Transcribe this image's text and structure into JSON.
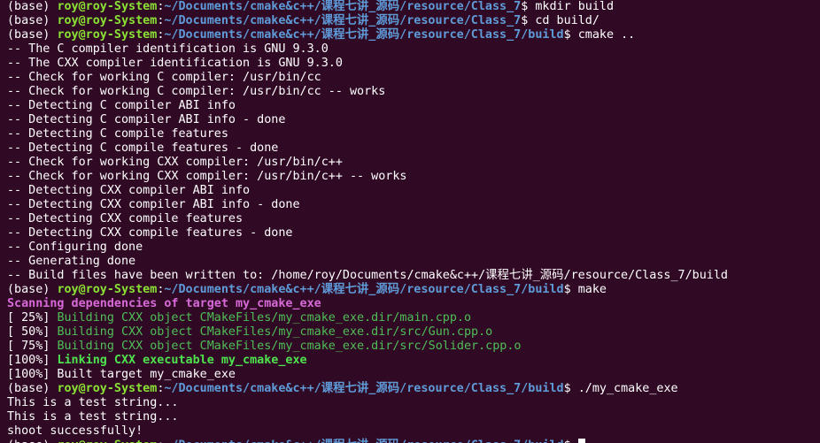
{
  "prompt": {
    "base": "(base) ",
    "user": "roy@roy-System",
    "colon": ":",
    "path_class": "~/Documents/cmake&c++/课程七讲_源码/resource/Class_7",
    "path_build": "~/Documents/cmake&c++/课程七讲_源码/resource/Class_7/build",
    "dollar": "$ "
  },
  "commands": {
    "mkdir": "mkdir build",
    "cd": "cd build/",
    "cmake": "cmake ..",
    "make": "make",
    "run": "./my_cmake_exe"
  },
  "cmake_output": [
    "-- The C compiler identification is GNU 9.3.0",
    "-- The CXX compiler identification is GNU 9.3.0",
    "-- Check for working C compiler: /usr/bin/cc",
    "-- Check for working C compiler: /usr/bin/cc -- works",
    "-- Detecting C compiler ABI info",
    "-- Detecting C compiler ABI info - done",
    "-- Detecting C compile features",
    "-- Detecting C compile features - done",
    "-- Check for working CXX compiler: /usr/bin/c++",
    "-- Check for working CXX compiler: /usr/bin/c++ -- works",
    "-- Detecting CXX compiler ABI info",
    "-- Detecting CXX compiler ABI info - done",
    "-- Detecting CXX compile features",
    "-- Detecting CXX compile features - done",
    "-- Configuring done",
    "-- Generating done",
    "-- Build files have been written to: /home/roy/Documents/cmake&c++/课程七讲_源码/resource/Class_7/build"
  ],
  "make_output": {
    "scanning": "Scanning dependencies of target my_cmake_exe",
    "build1_pct": "[ 25%] ",
    "build1": "Building CXX object CMakeFiles/my_cmake_exe.dir/main.cpp.o",
    "build2_pct": "[ 50%] ",
    "build2": "Building CXX object CMakeFiles/my_cmake_exe.dir/src/Gun.cpp.o",
    "build3_pct": "[ 75%] ",
    "build3": "Building CXX object CMakeFiles/my_cmake_exe.dir/src/Solider.cpp.o",
    "link_pct": "[100%] ",
    "link": "Linking CXX executable my_cmake_exe",
    "built": "[100%] Built target my_cmake_exe"
  },
  "program_output": [
    "This is a test string...",
    "This is a test string...",
    "shoot successfully!"
  ]
}
